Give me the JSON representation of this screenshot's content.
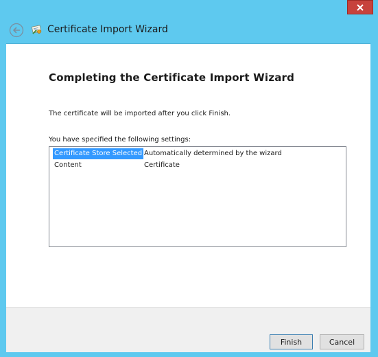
{
  "window": {
    "title": "Certificate Import Wizard"
  },
  "titlebar": {
    "close_icon": "close-icon",
    "back_icon": "back-arrow-icon",
    "wizard_icon": "certificate-icon"
  },
  "page": {
    "heading": "Completing the Certificate Import Wizard",
    "info_text": "The certificate will be imported after you click Finish.",
    "settings_label": "You have specified the following settings:"
  },
  "settings": [
    {
      "key": "Certificate Store Selected",
      "value": "Automatically determined by the wizard",
      "selected": true
    },
    {
      "key": "Content",
      "value": "Certificate",
      "selected": false
    }
  ],
  "buttons": {
    "finish": "Finish",
    "cancel": "Cancel"
  },
  "colors": {
    "frame": "#5ec9ef",
    "close": "#c7423c",
    "selection": "#3399ff"
  }
}
